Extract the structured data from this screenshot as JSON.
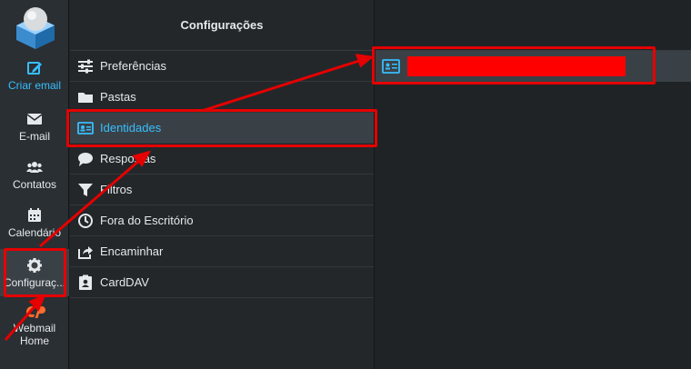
{
  "rail": {
    "compose_label": "Criar email",
    "mail_label": "E-mail",
    "contacts_label": "Contatos",
    "calendar_label": "Calendário",
    "settings_label": "Configuraç...",
    "webmail_label_1": "Webmail",
    "webmail_label_2": "Home"
  },
  "settings": {
    "title": "Configurações",
    "items": [
      {
        "label": "Preferências",
        "icon": "sliders-icon"
      },
      {
        "label": "Pastas",
        "icon": "folder-icon"
      },
      {
        "label": "Identidades",
        "icon": "id-card-icon"
      },
      {
        "label": "Respostas",
        "icon": "comment-icon"
      },
      {
        "label": "Filtros",
        "icon": "filter-icon"
      },
      {
        "label": "Fora do Escritório",
        "icon": "clock-icon"
      },
      {
        "label": "Encaminhar",
        "icon": "share-icon"
      },
      {
        "label": "CardDAV",
        "icon": "contact-book-icon"
      }
    ]
  },
  "colors": {
    "accent": "#37beff",
    "annotation": "#e60000",
    "redaction": "#ff0000"
  }
}
